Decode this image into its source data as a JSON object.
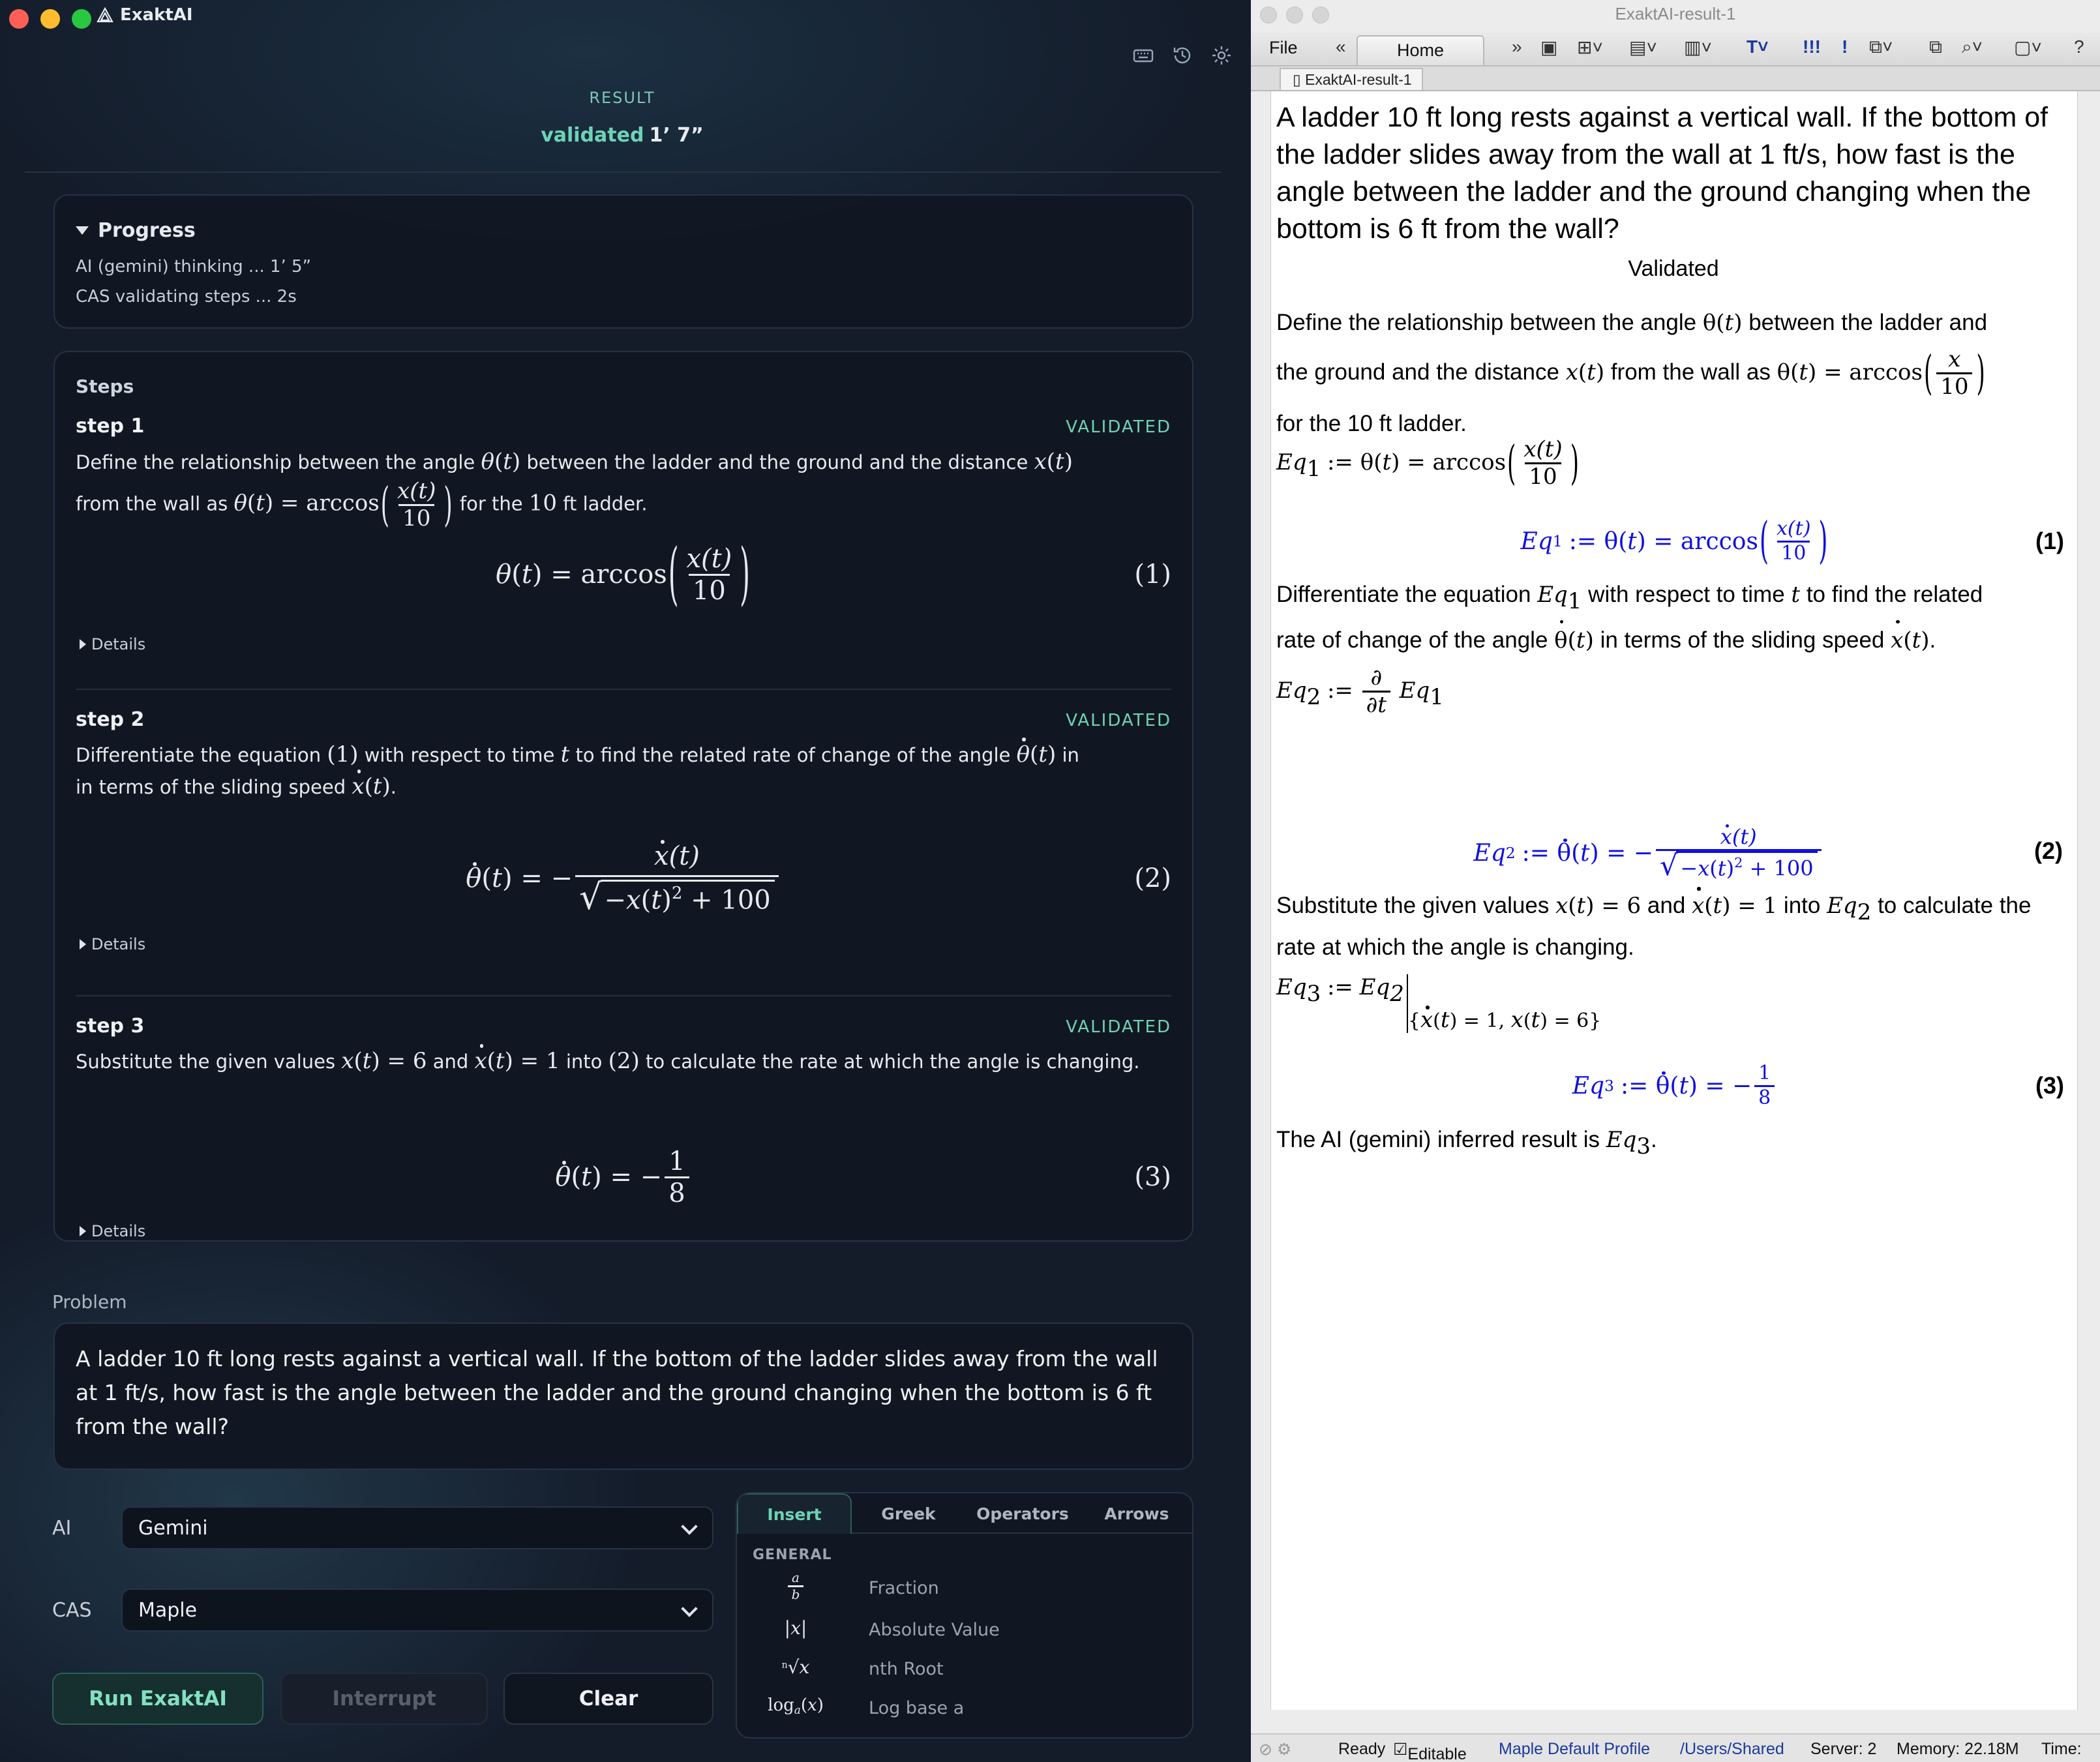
{
  "left": {
    "app_title": "ExaktAI",
    "result_label": "RESULT",
    "result_status": "validated",
    "result_time": "1’ 7”",
    "progress": {
      "title": "Progress",
      "lines": [
        "AI (gemini) thinking ... 1’ 5”",
        "CAS validating steps ... 2s"
      ]
    },
    "steps_title": "Steps",
    "steps": [
      {
        "label": "step 1",
        "status": "VALIDATED",
        "eq_number": "(1)",
        "details": "Details",
        "t1": "Define the relationship between the angle",
        "t2": "between the ladder and the ground and the distance",
        "t3": "from the wall as",
        "t4": "for the",
        "t5": "ft ladder.",
        "ten": "10"
      },
      {
        "label": "step 2",
        "status": "VALIDATED",
        "eq_number": "(2)",
        "details": "Details",
        "t1": "Differentiate the equation",
        "t2": "with respect to time",
        "t3": "to find the related rate of change of the angle",
        "t4": "in terms of the sliding speed",
        "ref": "(1)"
      },
      {
        "label": "step 3",
        "status": "VALIDATED",
        "eq_number": "(3)",
        "details": "Details",
        "t1": "Substitute the given values",
        "t2": "and",
        "t3": "into",
        "t4": "to calculate the rate at which the angle is changing.",
        "ref": "(2)"
      }
    ],
    "problem_label": "Problem",
    "problem_text": "A ladder 10 ft long rests against a vertical wall. If the bottom of the ladder slides away from the wall at 1 ft/s, how fast is the angle between the ladder and the ground changing when the bottom is 6 ft from the wall?",
    "ai_label": "AI",
    "ai_value": "Gemini",
    "cas_label": "CAS",
    "cas_value": "Maple",
    "buttons": {
      "run": "Run ExaktAI",
      "interrupt": "Interrupt",
      "clear": "Clear"
    },
    "palette": {
      "tabs": [
        "Insert",
        "Greek",
        "Operators",
        "Arrows"
      ],
      "section": "GENERAL",
      "items": [
        "Fraction",
        "Absolute Value",
        "nth Root",
        "Log base a"
      ]
    }
  },
  "right": {
    "window_title": "ExaktAI-result-1",
    "menu_file": "File",
    "tab_home": "Home",
    "doc_tab": "ExaktAI-result-1",
    "problem": "A ladder 10 ft long rests against a vertical wall. If the bottom of the ladder slides away from the wall at 1 ft/s, how fast is the angle between the ladder and the ground changing when the bottom is 6 ft from the wall?",
    "validated": "Validated",
    "p1a": "Define the relationship between the angle",
    "p1b": "between the ladder and",
    "p1c": "the ground and the distance",
    "p1d": "from the wall as",
    "p1e": "for the 10 ft ladder.",
    "p2a": "Differentiate the equation",
    "p2b": "with respect to time",
    "p2c": "to find the related",
    "p2d": "rate of change of the angle",
    "p2e": "in terms of the sliding speed",
    "p3a": "Substitute the given values",
    "p3b": "and",
    "p3c": "into",
    "p3d": "to calculate the",
    "p3e": "rate at which the angle is changing.",
    "p4": "The AI (gemini) inferred result is",
    "eq_numbers": [
      "(1)",
      "(2)",
      "(3)"
    ],
    "status": {
      "ready": "Ready",
      "editable": "Editable",
      "profile": "Maple Default Profile",
      "path": "/Users/Shared",
      "server": "Server: 2",
      "memory": "Memory: 22.18M",
      "time": "Time:"
    }
  },
  "colors": {
    "accent": "#6ed3b5",
    "maple_blue": "#1010e0",
    "left_bg": "#141c2a"
  }
}
